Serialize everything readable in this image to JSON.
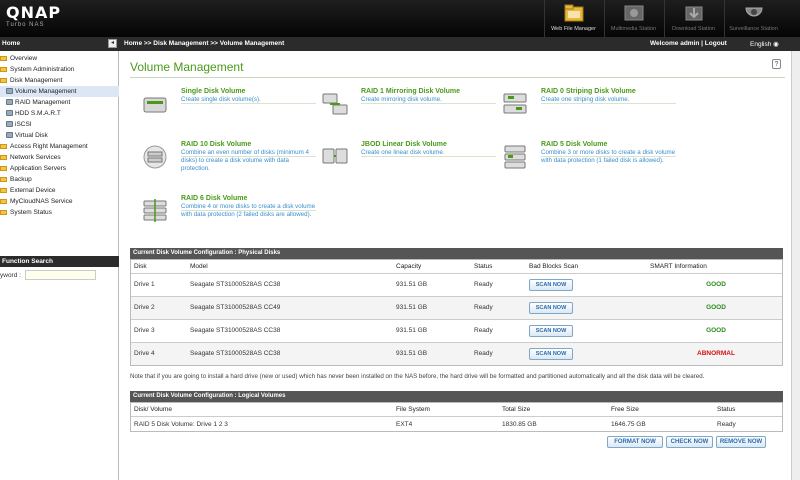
{
  "header": {
    "brand": "QNAP",
    "brand_sub": "Turbo NAS",
    "toolbar": [
      {
        "label": "Web File Manager",
        "icon": "web-file-manager-icon"
      },
      {
        "label": "Multimedia Station",
        "icon": "multimedia-station-icon"
      },
      {
        "label": "Download Station",
        "icon": "download-station-icon"
      },
      {
        "label": "Surveillance Station",
        "icon": "surveillance-station-icon"
      }
    ]
  },
  "topbar": {
    "home": "Home",
    "breadcrumb": "Home >> Disk Management >> Volume Management",
    "welcome": "Welcome admin | Logout",
    "language": "English"
  },
  "sidebar": {
    "items": [
      {
        "label": "Overview"
      },
      {
        "label": "System Administration"
      },
      {
        "label": "Disk Management"
      },
      {
        "label": "Volume Management"
      },
      {
        "label": "RAID Management"
      },
      {
        "label": "HDD S.M.A.R.T"
      },
      {
        "label": "iSCSI"
      },
      {
        "label": "Virtual Disk"
      },
      {
        "label": "Access Right Management"
      },
      {
        "label": "Network Services"
      },
      {
        "label": "Application Servers"
      },
      {
        "label": "Backup"
      },
      {
        "label": "External Device"
      },
      {
        "label": "MyCloudNAS Service"
      },
      {
        "label": "System Status"
      }
    ],
    "function_search": "Function Search",
    "keyword_label": "yword :",
    "keyword_value": ""
  },
  "main": {
    "title": "Volume Management",
    "volume_types": [
      {
        "title": "Single Disk Volume",
        "desc": "Create single disk volume(s)."
      },
      {
        "title": "RAID 1 Mirroring Disk Volume",
        "desc": "Create mirroring disk volume."
      },
      {
        "title": "RAID 0 Striping Disk Volume",
        "desc": "Create one striping disk volume."
      },
      {
        "title": "RAID 10 Disk Volume",
        "desc": "Combine an even number of disks (minimum 4 disks) to create a disk volume with data protection."
      },
      {
        "title": "JBOD Linear Disk Volume",
        "desc": "Create one linear disk volume."
      },
      {
        "title": "RAID 5 Disk Volume",
        "desc": "Combine 3 or more disks to create a disk volume with data protection (1 failed disk is allowed)."
      },
      {
        "title": "RAID 6 Disk Volume",
        "desc": "Combine 4 or more disks to create a disk volume with data protection (2 failed disks are allowed)."
      }
    ],
    "physical": {
      "heading": "Current Disk Volume Configuration : Physical Disks",
      "columns": [
        "Disk",
        "Model",
        "Capacity",
        "Status",
        "Bad Blocks Scan",
        "SMART Information"
      ],
      "scan_label": "SCAN NOW",
      "rows": [
        {
          "disk": "Drive 1",
          "model": "Seagate ST31000528AS CC38",
          "capacity": "931.51 GB",
          "status": "Ready",
          "smart": "GOOD"
        },
        {
          "disk": "Drive 2",
          "model": "Seagate ST31000528AS CC49",
          "capacity": "931.51 GB",
          "status": "Ready",
          "smart": "GOOD"
        },
        {
          "disk": "Drive 3",
          "model": "Seagate ST31000528AS CC38",
          "capacity": "931.51 GB",
          "status": "Ready",
          "smart": "GOOD"
        },
        {
          "disk": "Drive 4",
          "model": "Seagate ST31000528AS CC38",
          "capacity": "931.51 GB",
          "status": "Ready",
          "smart": "ABNORMAL"
        }
      ]
    },
    "note": "Note that if you are going to install a hard drive (new or used) which has never been installed on the NAS before, the hard drive will be formatted and partitioned automatically and all the disk data will be cleared.",
    "logical": {
      "heading": "Current Disk Volume Configuration : Logical Volumes",
      "columns": [
        "Disk/ Volume",
        "File System",
        "Total Size",
        "Free Size",
        "Status"
      ],
      "rows": [
        {
          "volume": "RAID 5 Disk Volume: Drive 1 2 3",
          "fs": "EXT4",
          "total": "1830.85 GB",
          "free": "1646.75 GB",
          "status": "Ready"
        }
      ]
    },
    "buttons": {
      "format": "FORMAT NOW",
      "check": "CHECK NOW",
      "remove": "REMOVE NOW"
    }
  },
  "colors": {
    "accent_green": "#4a9a1a",
    "link_blue": "#3a8fcc",
    "good": "#2d8a1c",
    "abnormal": "#d01010"
  }
}
